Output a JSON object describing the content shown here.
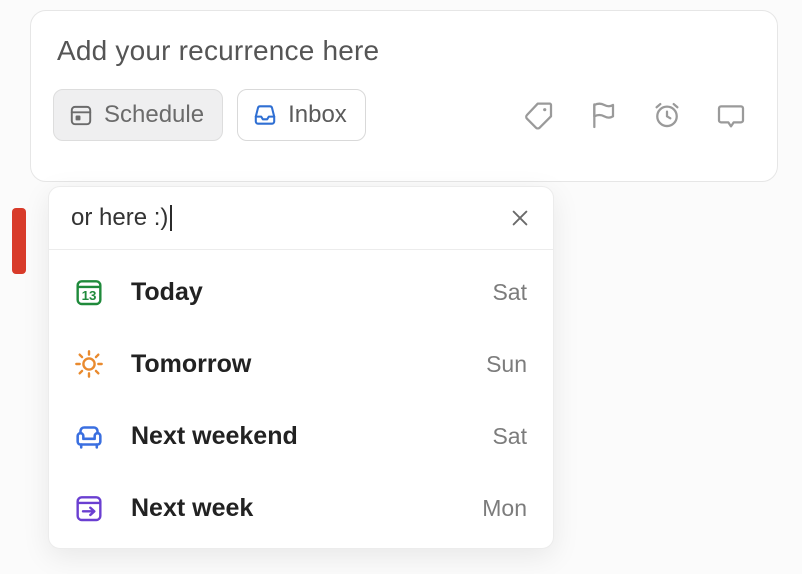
{
  "task": {
    "title": "Add your recurrence here",
    "schedule_label": "Schedule",
    "inbox_label": "Inbox"
  },
  "popover": {
    "search_text": "or here :)",
    "options": [
      {
        "label": "Today",
        "day": "Sat",
        "icon": "calendar-today-icon",
        "date_num": "13",
        "color": "#1f8a3b"
      },
      {
        "label": "Tomorrow",
        "day": "Sun",
        "icon": "sun-icon",
        "color": "#e98a2e"
      },
      {
        "label": "Next weekend",
        "day": "Sat",
        "icon": "couch-icon",
        "color": "#3a6fe0"
      },
      {
        "label": "Next week",
        "day": "Mon",
        "icon": "arrow-right-box-icon",
        "color": "#6a3fd1"
      }
    ]
  }
}
